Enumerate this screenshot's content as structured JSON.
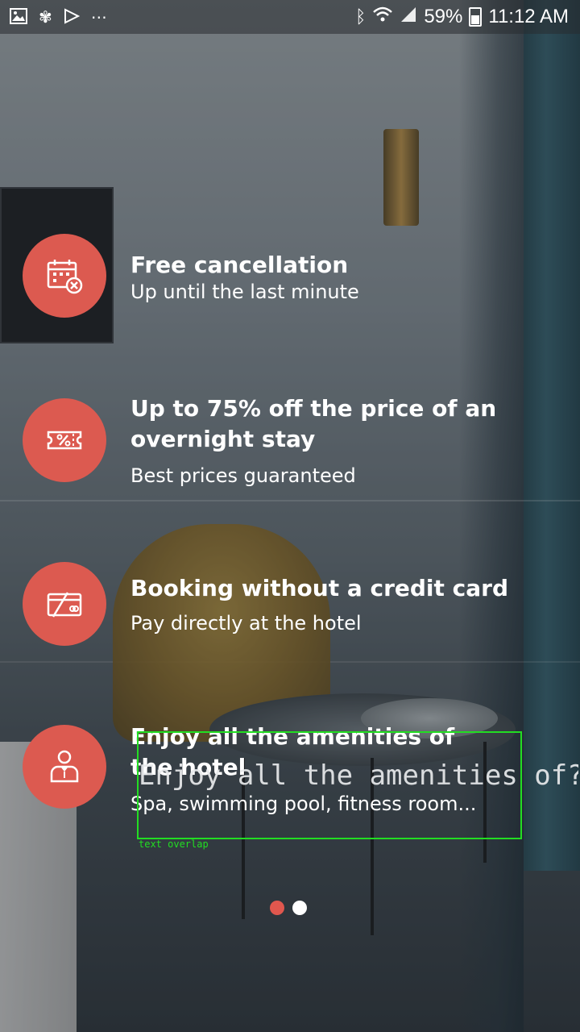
{
  "status_bar": {
    "left_icons": [
      "image-icon",
      "fan-icon",
      "play-store-icon",
      "more-icon"
    ],
    "right_icons": [
      "bluetooth-icon",
      "wifi-icon",
      "signal-icon"
    ],
    "battery_percent": "59%",
    "time": "11:12 AM"
  },
  "features": [
    {
      "icon": "calendar-cancel-icon",
      "title": "Free cancellation",
      "subtitle": "Up until the last minute"
    },
    {
      "icon": "discount-ticket-icon",
      "title": "Up to 75% off the price of an overnight stay",
      "subtitle": "Best prices guaranteed"
    },
    {
      "icon": "no-credit-card-icon",
      "title": "Booking without a credit card",
      "subtitle": "Pay directly at the hotel"
    },
    {
      "icon": "concierge-icon",
      "title": "Enjoy all the amenities of the hotel",
      "subtitle": "Spa, swimming pool, fitness room..."
    }
  ],
  "overlap": {
    "text": "Enjoy all the amenities of?t",
    "label": "text overlap",
    "color": "#22dd22"
  },
  "pager": {
    "total": 2,
    "active_index": 1
  },
  "colors": {
    "accent": "#dc5a50",
    "dot_active": "#e0574e",
    "dot_inactive": "#ffffff"
  }
}
